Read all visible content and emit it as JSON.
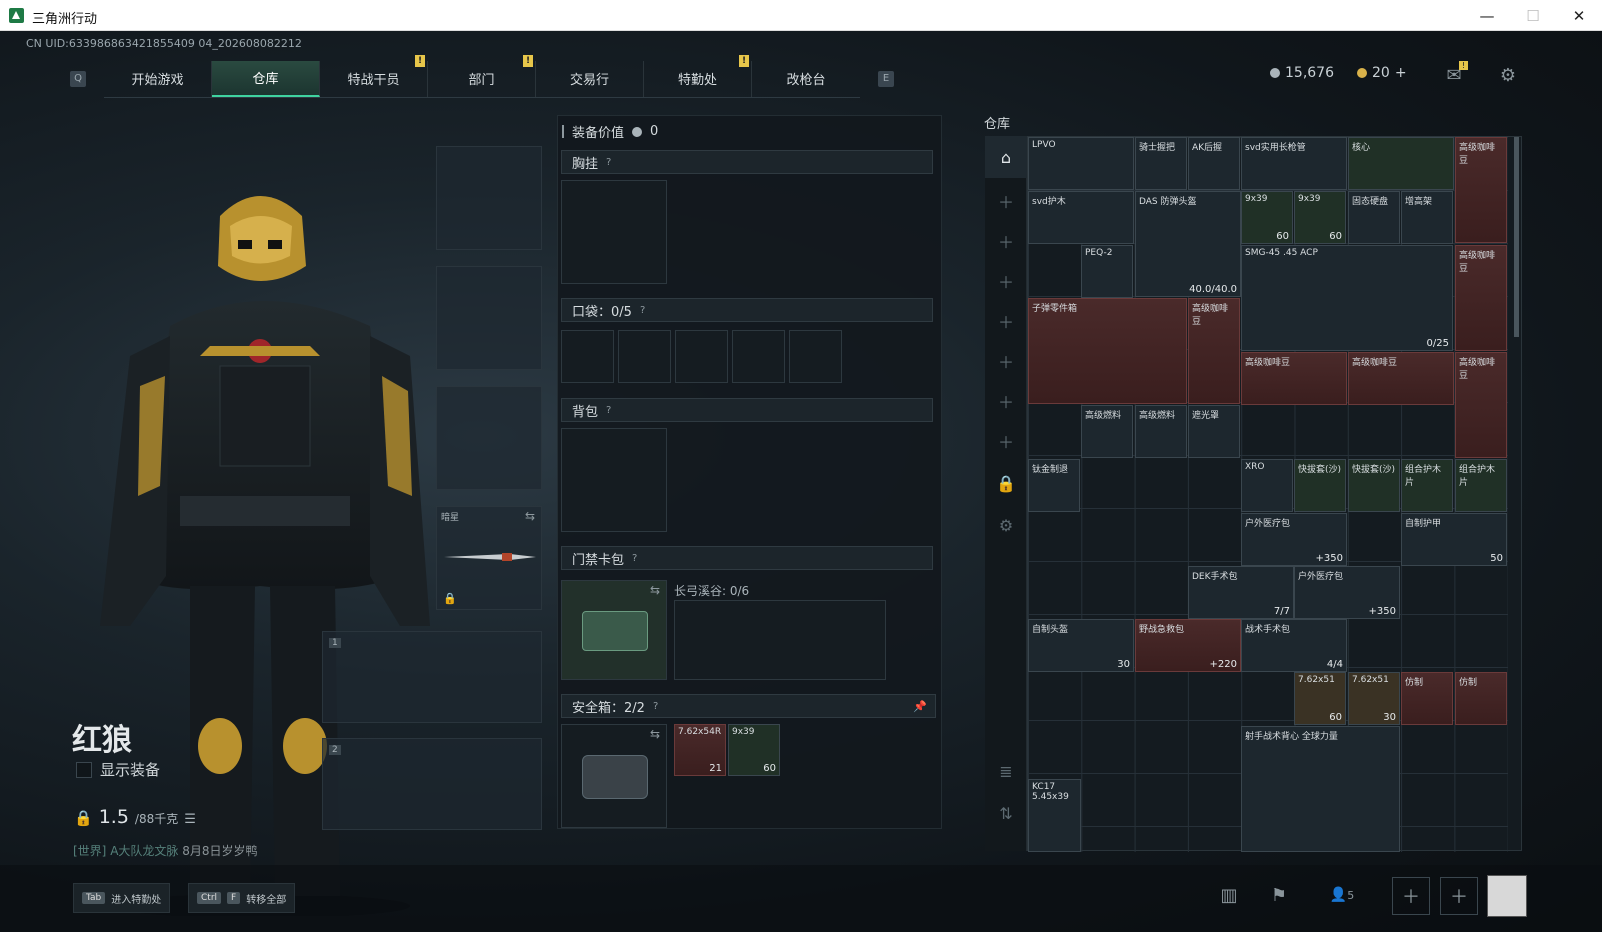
{
  "window": {
    "title": "三角洲行动",
    "minimize": "—",
    "maximize": "☐",
    "close": "✕"
  },
  "uid": "CN UID:633986863421855409 04_202608082212",
  "nav": {
    "left_key": "Q",
    "right_key": "E",
    "tabs": [
      {
        "label": "开始游戏",
        "mark": ""
      },
      {
        "label": "仓库",
        "mark": ""
      },
      {
        "label": "特战干员",
        "mark": "!"
      },
      {
        "label": "部门",
        "mark": "!"
      },
      {
        "label": "交易行",
        "mark": ""
      },
      {
        "label": "特勤处",
        "mark": "!"
      },
      {
        "label": "改枪台",
        "mark": ""
      }
    ]
  },
  "currency": {
    "silver": "15,676",
    "gold": "20",
    "plus": "+",
    "mail_mark": "!"
  },
  "operator": {
    "name": "红狼",
    "show_equipment": "显示装备",
    "weight_value": "1.5",
    "weight_unit": "/88千克",
    "chat_channel": "[世界]",
    "chat_user": "A大队龙文脉",
    "chat_text": "8月8日岁岁鸭",
    "weapon_label": "暗星"
  },
  "equip_panel": {
    "value_label": "装备价值",
    "value": "0",
    "chest": "胸挂",
    "pocket": "口袋：0/5",
    "backpack": "背包",
    "keycard": "门禁卡包",
    "keycard_slot": "长弓溪谷: 0/6",
    "safebox": "安全箱：2/2",
    "question": "?",
    "safebox_items": [
      {
        "label": "7.62x54R",
        "count": "21"
      },
      {
        "label": "9x39",
        "count": "60"
      }
    ]
  },
  "storage": {
    "title": "仓库",
    "items": [
      {
        "label": "LPVO",
        "count": ""
      },
      {
        "label": "骑士握把",
        "count": ""
      },
      {
        "label": "AK后握",
        "count": ""
      },
      {
        "label": "svd实用长枪管",
        "count": ""
      },
      {
        "label": "核心",
        "count": ""
      },
      {
        "label": "高级咖啡豆",
        "count": ""
      },
      {
        "label": "svd护木",
        "count": ""
      },
      {
        "label": "DAS 防弹头盔",
        "count": "40.0/40.0"
      },
      {
        "label": "9x39",
        "count": "60"
      },
      {
        "label": "9x39",
        "count": "60"
      },
      {
        "label": "固态硬盘",
        "count": ""
      },
      {
        "label": "增高架",
        "count": ""
      },
      {
        "label": "PEQ-2",
        "count": ""
      },
      {
        "label": "SMG-45 .45 ACP",
        "count": "0/25"
      },
      {
        "label": "高级咖啡豆",
        "count": ""
      },
      {
        "label": "子弹零件箱",
        "count": ""
      },
      {
        "label": "高级咖啡豆",
        "count": ""
      },
      {
        "label": "高级咖啡豆",
        "count": ""
      },
      {
        "label": "高级咖啡豆",
        "count": ""
      },
      {
        "label": "高级咖啡豆",
        "count": ""
      },
      {
        "label": "高级燃料",
        "count": ""
      },
      {
        "label": "高级燃料",
        "count": ""
      },
      {
        "label": "遮光罩",
        "count": ""
      },
      {
        "label": "钛金制退",
        "count": ""
      },
      {
        "label": "XRO",
        "count": ""
      },
      {
        "label": "快拔套(沙)",
        "count": ""
      },
      {
        "label": "快拔套(沙)",
        "count": ""
      },
      {
        "label": "组合护木片",
        "count": ""
      },
      {
        "label": "组合护木片",
        "count": ""
      },
      {
        "label": "户外医疗包",
        "count": "+350"
      },
      {
        "label": "自制护甲",
        "count": "50"
      },
      {
        "label": "DEK手术包",
        "count": "7/7"
      },
      {
        "label": "户外医疗包",
        "count": "+350"
      },
      {
        "label": "自制头盔",
        "count": "30"
      },
      {
        "label": "野战急救包",
        "count": "+220"
      },
      {
        "label": "战术手术包",
        "count": "4/4"
      },
      {
        "label": "7.62x51",
        "count": "60"
      },
      {
        "label": "7.62x51",
        "count": "30"
      },
      {
        "label": "仿制",
        "count": ""
      },
      {
        "label": "仿制",
        "count": ""
      },
      {
        "label": "射手战术背心 全球力量",
        "count": ""
      },
      {
        "label": "KC17 5.45x39",
        "count": ""
      }
    ]
  },
  "bottom": {
    "tab_key": "Tab",
    "tab_label": "进入特勤处",
    "ctrl_key": "Ctrl",
    "f_key": "F",
    "transfer_label": "转移全部",
    "squad_count": "5"
  }
}
